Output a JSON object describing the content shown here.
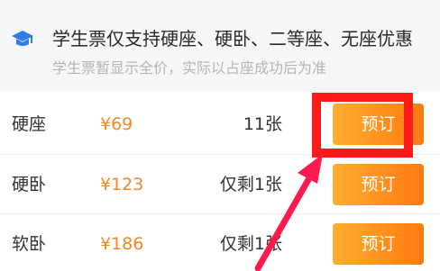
{
  "notice": {
    "icon": "graduation-cap-icon",
    "title": "学生票仅支持硬座、硬卧、二等座、无座优惠",
    "subtitle": "学生票暂显示全价，实际以占座成功后为准"
  },
  "rows": [
    {
      "seat": "硬座",
      "price": "¥69",
      "count": "11张",
      "button": "预订"
    },
    {
      "seat": "硬卧",
      "price": "¥123",
      "count": "仅剩1张",
      "button": "预订"
    },
    {
      "seat": "软卧",
      "price": "¥186",
      "count": "仅剩1张",
      "button": "预订"
    }
  ],
  "colors": {
    "price": "#f0882a",
    "button_start": "#ffae2d",
    "button_end": "#ff7a12",
    "icon": "#2f7be8",
    "annotation": "#ff1a1a"
  }
}
